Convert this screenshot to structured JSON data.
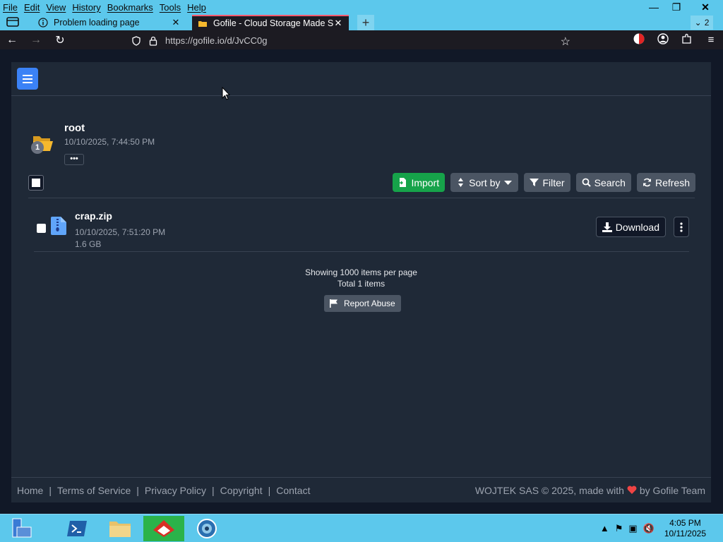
{
  "browser": {
    "menu": [
      "File",
      "Edit",
      "View",
      "History",
      "Bookmarks",
      "Tools",
      "Help"
    ],
    "tabs": [
      {
        "title": "Problem loading page",
        "close": "✕"
      },
      {
        "title": "Gofile - Cloud Storage Made Sir",
        "close": "✕"
      }
    ],
    "new_tab": "+",
    "tab_count": "2",
    "url": "https://gofile.io/d/JvCC0g",
    "window_buttons": {
      "minimize": "—",
      "restore": "❐",
      "close": "✕"
    }
  },
  "folder": {
    "name": "root",
    "date": "10/10/2025, 7:44:50 PM",
    "badge": "1",
    "more": "•••"
  },
  "toolbar": {
    "import": "Import",
    "sort": "Sort by",
    "filter": "Filter",
    "search": "Search",
    "refresh": "Refresh"
  },
  "files": [
    {
      "name": "crap.zip",
      "date": "10/10/2025, 7:51:20 PM",
      "size": "1.6 GB",
      "download": "Download"
    }
  ],
  "pagination": {
    "per_page": "Showing 1000 items per page",
    "total": "Total 1 items"
  },
  "report_abuse": "Report Abuse",
  "footer": {
    "links": [
      "Home",
      "Terms of Service",
      "Privacy Policy",
      "Copyright",
      "Contact"
    ],
    "copyright": "WOJTEK SAS © 2025, made with",
    "by": "by Gofile Team"
  },
  "taskbar": {
    "time": "4:05 PM",
    "date": "10/11/2025"
  },
  "colors": {
    "accent_blue": "#3b82f6",
    "import_green": "#16a34a",
    "page_bg": "#111827",
    "card_bg": "#1f2937"
  }
}
